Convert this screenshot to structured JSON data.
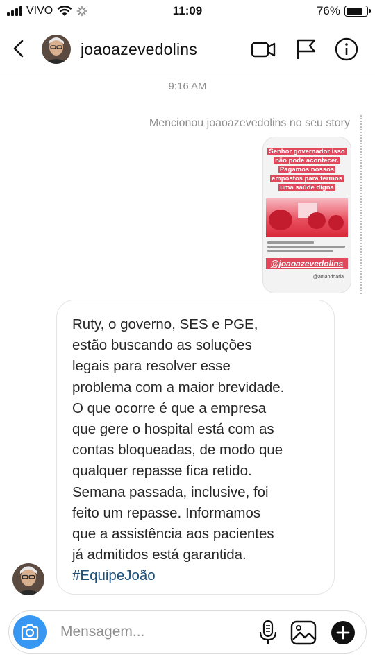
{
  "status_bar": {
    "carrier": "VIVO",
    "time": "11:09",
    "battery": "76%",
    "battery_level": 0.76
  },
  "header": {
    "username": "joaoazevedolins"
  },
  "chat": {
    "timestamp": "9:16 AM",
    "mention_note": "Mencionou joaoazevedolins no seu story",
    "story": {
      "caption_lines": [
        "Senhor governador isso",
        "não pode acontecer.",
        "Pagamos nossos",
        "empostos para termos",
        "uma saúde digna"
      ],
      "mention_handle": "@joaoazevedolins",
      "credit": "@amandoaria"
    },
    "message": {
      "text": "Ruty, o governo, SES e PGE,\nestão buscando as soluções\nlegais para resolver esse\nproblema com a maior brevidade.\nO que ocorre é que a empresa\nque gere o hospital está com as\ncontas bloqueadas, de modo que\nqualquer repasse fica retido.\nSemana passada, inclusive, foi\nfeito um repasse. Informamos\nque a assistência aos pacientes\njá admitidos está garantida.",
      "hashtag": "#EquipeJoão"
    }
  },
  "composer": {
    "placeholder": "Mensagem..."
  },
  "colors": {
    "accent_blue": "#3897f0",
    "story_red": "#e0485c",
    "hashtag": "#1c4f7a",
    "muted_text": "#8e8e8e"
  }
}
